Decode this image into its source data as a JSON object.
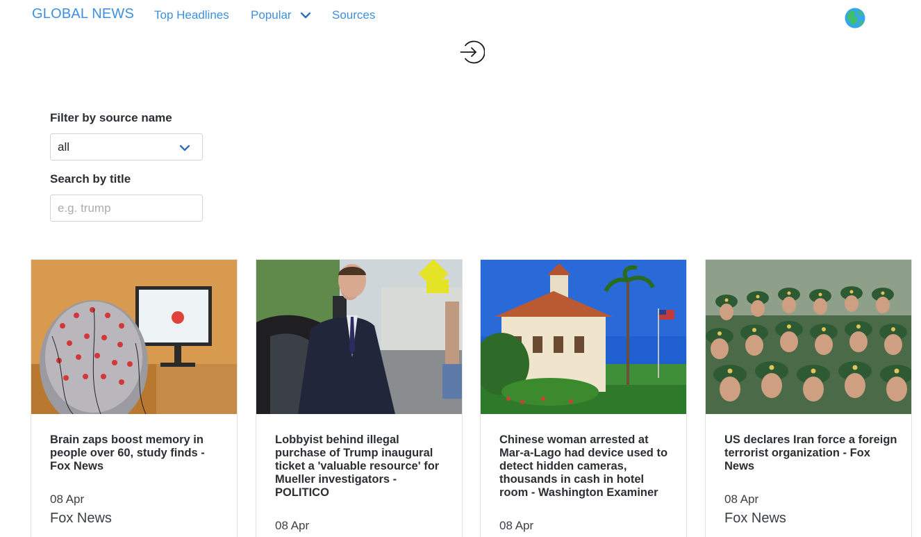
{
  "nav": {
    "brand": "GLOBAL NEWS",
    "links": [
      {
        "label": "Top Headlines"
      },
      {
        "label": "Popular"
      },
      {
        "label": "Sources"
      }
    ],
    "accent_color": "#3d8fe0",
    "icons": [
      "chevron-down-icon",
      "globe-icon",
      "login-icon"
    ]
  },
  "filters": {
    "source_label": "Filter by source name",
    "source_selected": "all",
    "search_label": "Search by title",
    "search_placeholder": "e.g. trump",
    "search_value": ""
  },
  "articles": [
    {
      "title": "Brain zaps boost memory in people over 60, study finds - Fox News",
      "date": "08 Apr",
      "source": "Fox News",
      "image": "eeg-cap-photo"
    },
    {
      "title": "Lobbyist behind illegal purchase of Trump inaugural ticket a 'valuable resource' for Mueller investigators - POLITICO",
      "date": "08 Apr",
      "source": "",
      "image": "man-entering-car-photo"
    },
    {
      "title": "Chinese woman arrested at Mar-a-Lago had device used to detect hidden cameras, thousands in cash in hotel room - Washington Examiner",
      "date": "08 Apr",
      "source": "",
      "image": "mar-a-lago-photo"
    },
    {
      "title": "US declares Iran force a foreign terrorist organization - Fox News",
      "date": "08 Apr",
      "source": "Fox News",
      "image": "soldiers-parade-photo"
    }
  ]
}
